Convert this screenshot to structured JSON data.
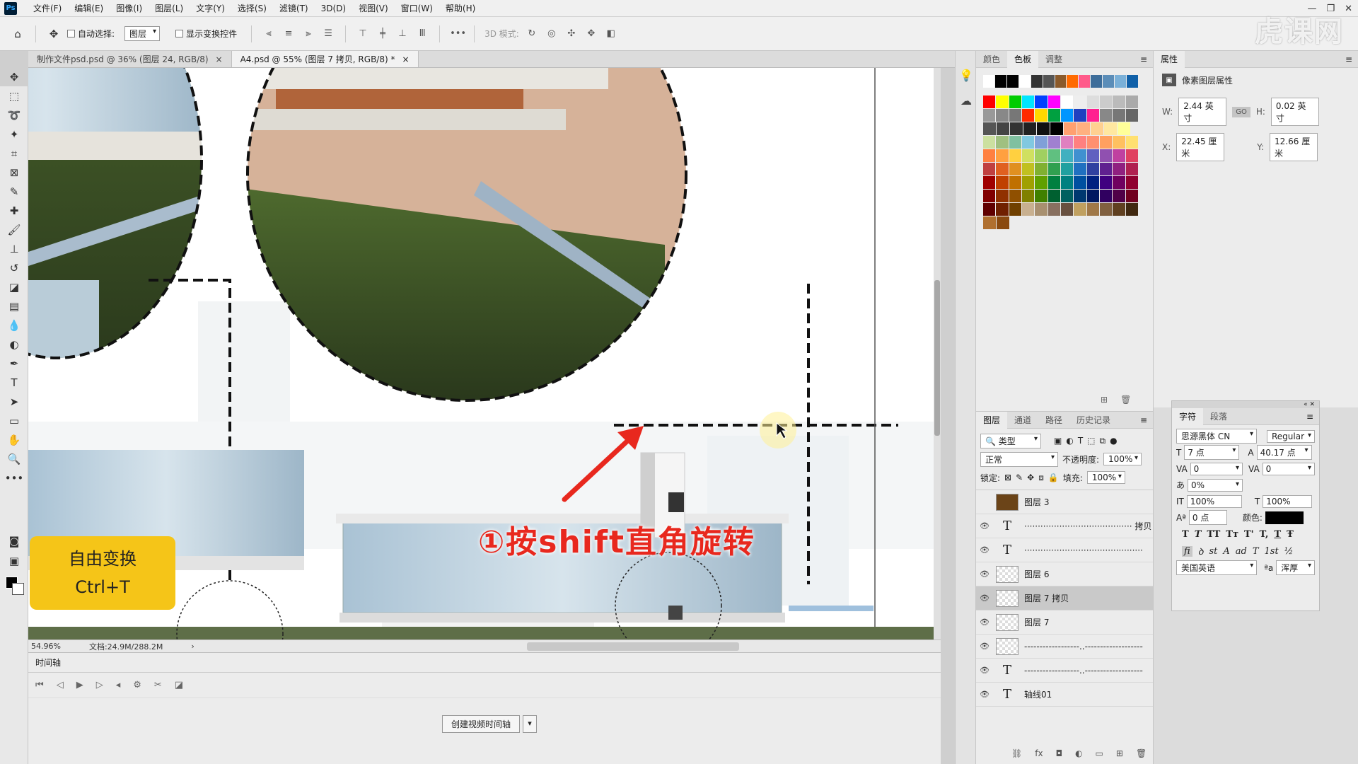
{
  "app": {
    "logo": "Ps"
  },
  "menu": [
    "文件(F)",
    "编辑(E)",
    "图像(I)",
    "图层(L)",
    "文字(Y)",
    "选择(S)",
    "滤镜(T)",
    "3D(D)",
    "视图(V)",
    "窗口(W)",
    "帮助(H)"
  ],
  "options": {
    "auto_select_label": "自动选择:",
    "auto_select_value": "图层",
    "show_transform_label": "显示变换控件",
    "mode_3d": "3D 模式:"
  },
  "watermark": "虎课网",
  "tabs": [
    {
      "label": "制作文件psd.psd @ 36% (图层 24, RGB/8)",
      "close": "×"
    },
    {
      "label": "A4.psd @ 55% (图层 7 拷贝, RGB/8) *",
      "close": "×"
    }
  ],
  "status": {
    "zoom": "54.96%",
    "doc": "文档:24.9M/288.2M",
    "arrow": "›"
  },
  "timeline": {
    "title": "时间轴",
    "create_button": "创建视频时间轴"
  },
  "swatch_tabs": [
    "颜色",
    "色板",
    "调整"
  ],
  "swatches": [
    [
      "#ffffff",
      "#000000",
      "#000000",
      "#ffffff",
      "#333333",
      "#555555",
      "#8b5a2b",
      "#ff6a00",
      "#ff5a8a",
      "#3d6d9a",
      "#5b8db8",
      "#7ab0d8",
      "#1060a8"
    ],
    [
      "#ff0000",
      "#ffff00",
      "#00cc00",
      "#00e5ff",
      "#0040ff",
      "#ff00ff",
      "#ffffff",
      "#eeeeee",
      "#dddddd",
      "#cccccc",
      "#bbbbbb",
      "#aaaaaa"
    ],
    [
      "#999999",
      "#888888",
      "#777777",
      "#ff2a00",
      "#ffd800",
      "#00a040",
      "#0096ff",
      "#2040c0",
      "#ff2090",
      "#888888",
      "#777777",
      "#666666"
    ],
    [
      "#555555",
      "#444444",
      "#333333",
      "#222222",
      "#111111",
      "#000000",
      "#ffa070",
      "#ffb080",
      "#ffd090",
      "#ffe8a0",
      "#ffff99"
    ],
    [
      "#cce0a0",
      "#a0c080",
      "#80c0a0",
      "#80c8e0",
      "#80a0d8",
      "#a080d0",
      "#e080c0",
      "#ff8080",
      "#ff9070",
      "#ffa060",
      "#ffc060",
      "#ffe070"
    ],
    [
      "#ff8040",
      "#ffa040",
      "#ffd040",
      "#d0e060",
      "#a0d060",
      "#60c080",
      "#40b0c0",
      "#4090d0",
      "#6060c0",
      "#9050b0",
      "#c040a0",
      "#e04060"
    ],
    [
      "#c04040",
      "#e06020",
      "#e09020",
      "#c0c020",
      "#80b030",
      "#30a050",
      "#20a0a0",
      "#2070c0",
      "#3040a0",
      "#602090",
      "#902080",
      "#b02050"
    ],
    [
      "#a00000",
      "#c04000",
      "#c07000",
      "#a0a000",
      "#60a000",
      "#008040",
      "#008080",
      "#0050a0",
      "#002080",
      "#400080",
      "#700060",
      "#900030"
    ],
    [
      "#800000",
      "#903000",
      "#905000",
      "#808000",
      "#408000",
      "#006030",
      "#006060",
      "#003870",
      "#001860",
      "#300060",
      "#500048",
      "#700020"
    ],
    [
      "#600000",
      "#702000",
      "#704000",
      "#c8b090",
      "#a89070",
      "#887060",
      "#685040",
      "#c0a060",
      "#a07848",
      "#806040",
      "#604020",
      "#402810"
    ],
    [
      "#b07030",
      "#8a4a10"
    ]
  ],
  "layer_tabs": [
    "图层",
    "通道",
    "路径",
    "历史记录"
  ],
  "layer_ctrl": {
    "kind": "类型",
    "blend": "正常",
    "opacity_label": "不透明度:",
    "opacity": "100%",
    "lock_label": "锁定:",
    "fill_label": "填充:",
    "fill": "100%"
  },
  "layers": [
    {
      "name": "图层 3",
      "type": "color"
    },
    {
      "name": "········································ 拷贝",
      "type": "text"
    },
    {
      "name": "············································",
      "type": "text"
    },
    {
      "name": "图层 6",
      "type": "pixel"
    },
    {
      "name": "图层 7 拷贝",
      "type": "pixel",
      "selected": true
    },
    {
      "name": "图层 7",
      "type": "pixel"
    },
    {
      "name": "------------------..-------------------",
      "type": "pixel"
    },
    {
      "name": "------------------..-------------------",
      "type": "text"
    },
    {
      "name": "轴线01",
      "type": "text"
    }
  ],
  "props": {
    "title": "属性",
    "subtitle": "像素图层属性",
    "w_label": "W:",
    "w": "2.44 英寸",
    "h_label": "H:",
    "h": "0.02 英寸",
    "x_label": "X:",
    "x": "22.45 厘米",
    "y_label": "Y:",
    "y": "12.66 厘米",
    "link": "GO"
  },
  "char": {
    "tabs": [
      "字符",
      "段落"
    ],
    "font": "思源黑体 CN",
    "style": "Regular",
    "size": "7 点",
    "leading": "40.17 点",
    "kerning": "0",
    "tracking": "0",
    "scale_pct": "0%",
    "vscale": "100%",
    "hscale": "100%",
    "baseline": "0 点",
    "color_label": "颜色:",
    "lang": "美国英语",
    "aa_label": "ªa",
    "aa": "浑厚",
    "buttons": [
      "T",
      "T",
      "TT",
      "Tт",
      "T'",
      "T,",
      "T",
      "Ŧ"
    ],
    "ot_buttons": [
      "fi",
      "ꝺ",
      "st",
      "A",
      "ad",
      "T",
      "1st",
      "½"
    ]
  },
  "tip": {
    "line1": "自由变换",
    "line2": "Ctrl+T"
  },
  "annotation": "①按shift直角旋转"
}
